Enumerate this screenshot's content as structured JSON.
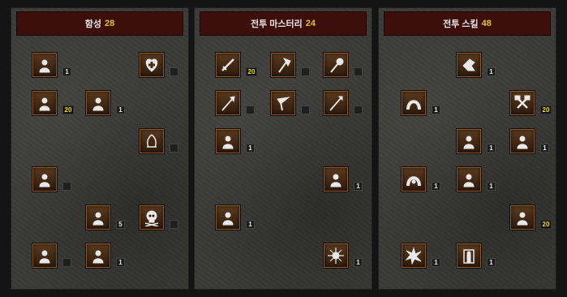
{
  "panels": [
    {
      "title": "함성",
      "points": "28"
    },
    {
      "title": "전투 마스터리",
      "points": "24"
    },
    {
      "title": "전투 스킬",
      "points": "48"
    }
  ],
  "skills": [
    {
      "id": "warcry-1",
      "icon": "shout-icon",
      "rank": "1"
    },
    {
      "id": "warcry-2",
      "icon": "flag-shout-icon",
      "rank": "20"
    },
    {
      "id": "warcry-3",
      "icon": "battle-cry-icon",
      "rank": "1"
    },
    {
      "id": "warcry-4",
      "icon": "heal-cross-icon",
      "rank": ""
    },
    {
      "id": "warcry-5",
      "icon": "taunt-icon",
      "rank": ""
    },
    {
      "id": "warcry-6",
      "icon": "howl-icon",
      "rank": ""
    },
    {
      "id": "warcry-7",
      "icon": "battle-orders-icon",
      "rank": "5"
    },
    {
      "id": "warcry-8",
      "icon": "skull-icon",
      "rank": ""
    },
    {
      "id": "warcry-9",
      "icon": "war-cry-icon",
      "rank": ""
    },
    {
      "id": "warcry-10",
      "icon": "battle-command-icon",
      "rank": "1"
    },
    {
      "id": "mastery-1",
      "icon": "sword-icon",
      "rank": "20"
    },
    {
      "id": "mastery-2",
      "icon": "axe-icon",
      "rank": ""
    },
    {
      "id": "mastery-3",
      "icon": "mace-icon",
      "rank": ""
    },
    {
      "id": "mastery-4",
      "icon": "polearm-icon",
      "rank": ""
    },
    {
      "id": "mastery-5",
      "icon": "throwing-icon",
      "rank": ""
    },
    {
      "id": "mastery-6",
      "icon": "spear-icon",
      "rank": ""
    },
    {
      "id": "mastery-7",
      "icon": "increased-speed-icon",
      "rank": "1"
    },
    {
      "id": "mastery-8",
      "icon": "iron-skin-icon",
      "rank": "1"
    },
    {
      "id": "mastery-9",
      "icon": "natural-resistance-icon",
      "rank": "1"
    },
    {
      "id": "mastery-10",
      "icon": "burst-icon",
      "rank": "1"
    },
    {
      "id": "combat-1",
      "icon": "bash-icon",
      "rank": "1"
    },
    {
      "id": "combat-2",
      "icon": "leap-icon",
      "rank": "1"
    },
    {
      "id": "combat-3",
      "icon": "double-swing-icon",
      "rank": "20"
    },
    {
      "id": "combat-4",
      "icon": "stun-icon",
      "rank": "1"
    },
    {
      "id": "combat-5",
      "icon": "double-throw-icon",
      "rank": "1"
    },
    {
      "id": "combat-6",
      "icon": "leap-attack-icon",
      "rank": "1"
    },
    {
      "id": "combat-7",
      "icon": "concentrate-icon",
      "rank": "1"
    },
    {
      "id": "combat-8",
      "icon": "frenzy-icon",
      "rank": "20"
    },
    {
      "id": "combat-9",
      "icon": "whirlwind-icon",
      "rank": "1"
    },
    {
      "id": "combat-10",
      "icon": "berserk-icon",
      "rank": "1"
    }
  ],
  "colors": {
    "rank_highlight": "#f0e000",
    "points_highlight": "#e0c23a",
    "header_bg": "#3c0f0c",
    "icon_frame": "#8a5a2c"
  }
}
